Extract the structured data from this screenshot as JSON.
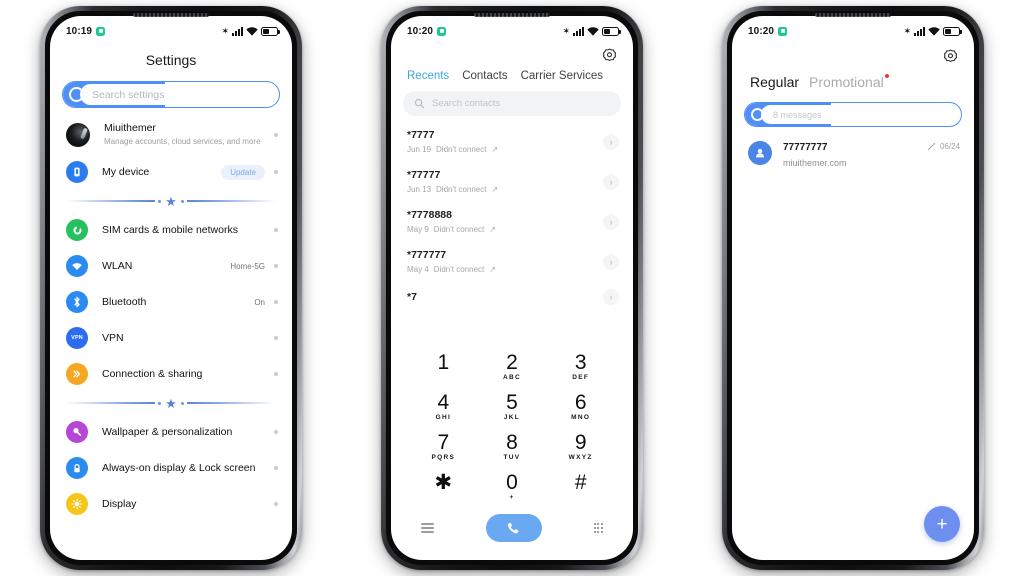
{
  "phone_settings": {
    "status_bar": {
      "time": "10:19",
      "icons": [
        "recording-dot-icon",
        "bluetooth-icon",
        "signal-bars-icon",
        "wifi-icon",
        "battery-icon"
      ]
    },
    "title": "Settings",
    "search": {
      "placeholder": "Search settings",
      "icon": "search-circle-icon"
    },
    "items": [
      {
        "label": "Miuithemer",
        "sublabel": "Manage accounts, cloud services, and more",
        "value": "",
        "icon": "account-avatar",
        "color": "#111111"
      },
      {
        "label": "My device",
        "sublabel": "",
        "value": "Update",
        "icon": "device-icon",
        "color": "#2a7df0"
      },
      {
        "label": "SIM cards & mobile networks",
        "sublabel": "",
        "value": "",
        "icon": "sim-card-icon",
        "color": "#27c05f"
      },
      {
        "label": "WLAN",
        "sublabel": "",
        "value": "Home-5G",
        "icon": "wifi-icon",
        "color": "#2a8cf0"
      },
      {
        "label": "Bluetooth",
        "sublabel": "",
        "value": "On",
        "icon": "bluetooth-icon",
        "color": "#2a8cf0"
      },
      {
        "label": "VPN",
        "sublabel": "",
        "value": "",
        "icon": "vpn-icon",
        "color": "#2a6df0"
      },
      {
        "label": "Connection & sharing",
        "sublabel": "",
        "value": "",
        "icon": "connection-sharing-icon",
        "color": "#f5a623"
      },
      {
        "label": "Wallpaper & personalization",
        "sublabel": "",
        "value": "",
        "icon": "wallpaper-icon",
        "color": "#b745d6"
      },
      {
        "label": "Always-on display & Lock screen",
        "sublabel": "",
        "value": "",
        "icon": "lock-icon",
        "color": "#2a8cf0"
      },
      {
        "label": "Display",
        "sublabel": "",
        "value": "",
        "icon": "brightness-icon",
        "color": "#f5c518"
      }
    ],
    "divider_icon": "star-divider-icon"
  },
  "phone_dialer": {
    "status_bar": {
      "time": "10:20"
    },
    "settings_icon": "gear-icon",
    "tabs": [
      {
        "label": "Recents",
        "active": true
      },
      {
        "label": "Contacts",
        "active": false
      },
      {
        "label": "Carrier Services",
        "active": false
      }
    ],
    "search": {
      "placeholder": "Search contacts",
      "icon": "search-icon"
    },
    "calls": [
      {
        "number": "*7777",
        "date": "Jun 19",
        "status": "Didn't connect",
        "direction_icon": "outgoing-arrow-icon"
      },
      {
        "number": "*77777",
        "date": "Jun 13",
        "status": "Didn't connect",
        "direction_icon": "outgoing-arrow-icon"
      },
      {
        "number": "*7778888",
        "date": "May 9",
        "status": "Didn't connect",
        "direction_icon": "outgoing-arrow-icon"
      },
      {
        "number": "*777777",
        "date": "May 4",
        "status": "Didn't connect",
        "direction_icon": "outgoing-arrow-icon"
      },
      {
        "number": "*7",
        "date": "",
        "status": "",
        "direction_icon": "outgoing-arrow-icon"
      }
    ],
    "keypad": [
      {
        "digit": "1",
        "letters": ""
      },
      {
        "digit": "2",
        "letters": "ABC"
      },
      {
        "digit": "3",
        "letters": "DEF"
      },
      {
        "digit": "4",
        "letters": "GHI"
      },
      {
        "digit": "5",
        "letters": "JKL"
      },
      {
        "digit": "6",
        "letters": "MNO"
      },
      {
        "digit": "7",
        "letters": "PQRS"
      },
      {
        "digit": "8",
        "letters": "TUV"
      },
      {
        "digit": "9",
        "letters": "WXYZ"
      },
      {
        "digit": "✱",
        "letters": ""
      },
      {
        "digit": "0",
        "letters": "+"
      },
      {
        "digit": "#",
        "letters": ""
      }
    ],
    "bottom_bar": {
      "menu_icon": "hamburger-menu-icon",
      "call_icon": "phone-call-icon",
      "keypad_icon": "dialpad-grid-icon",
      "call_button_color": "#6aa8f2"
    }
  },
  "phone_messages": {
    "status_bar": {
      "time": "10:20"
    },
    "settings_icon": "gear-icon",
    "tabs": [
      {
        "label": "Regular",
        "active": true,
        "badge": false
      },
      {
        "label": "Promotional",
        "active": false,
        "badge": true
      }
    ],
    "badge_color": "#ee3b30",
    "search": {
      "placeholder": "8 messages",
      "icon": "search-circle-icon"
    },
    "threads": [
      {
        "name": "77777777",
        "preview": "miuithemer.com",
        "date": "06/24",
        "edit_icon": "pencil-icon",
        "avatar_icon": "person-avatar-icon"
      }
    ],
    "fab": {
      "icon": "plus-icon",
      "color": "#6c8ff0"
    }
  }
}
